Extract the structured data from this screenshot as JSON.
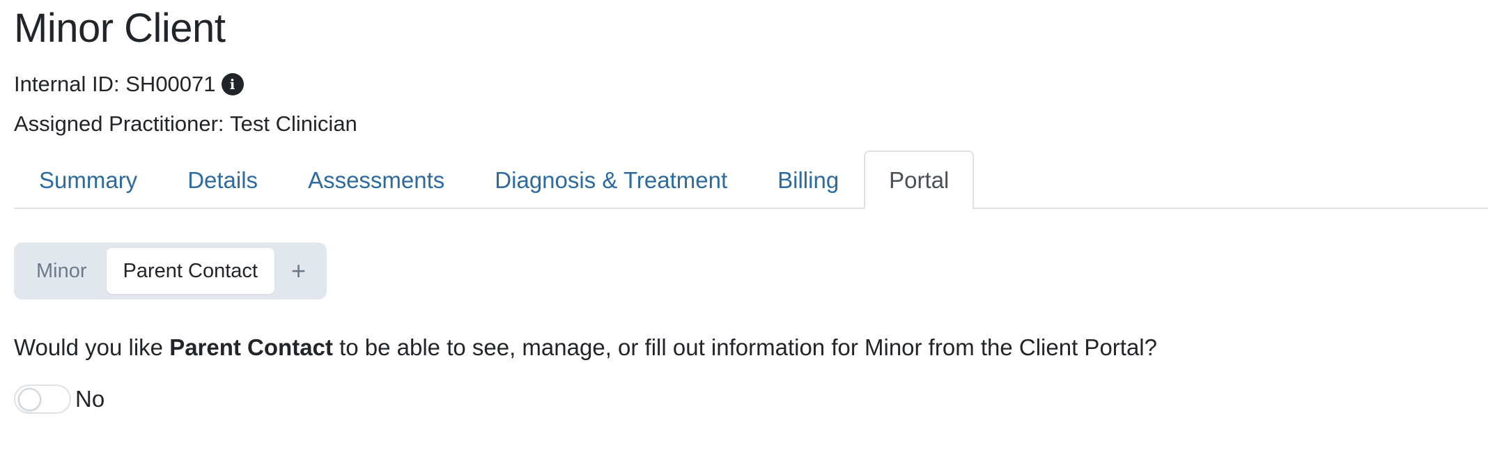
{
  "client": {
    "name": "Minor Client",
    "internal_id_label": "Internal ID:",
    "internal_id": "SH00071",
    "practitioner_label": "Assigned Practitioner:",
    "practitioner": "Test Clinician"
  },
  "tabs": [
    {
      "label": "Summary",
      "active": false
    },
    {
      "label": "Details",
      "active": false
    },
    {
      "label": "Assessments",
      "active": false
    },
    {
      "label": "Diagnosis & Treatment",
      "active": false
    },
    {
      "label": "Billing",
      "active": false
    },
    {
      "label": "Portal",
      "active": true
    }
  ],
  "portal": {
    "subtabs": [
      {
        "label": "Minor",
        "active": false
      },
      {
        "label": "Parent Contact",
        "active": true
      }
    ],
    "add_label": "+",
    "question_prefix": "Would you like",
    "question_contact": "Parent Contact",
    "question_suffix": "to be able to see, manage, or fill out information for Minor from the Client Portal?",
    "toggle_on": false,
    "toggle_label": "No"
  },
  "icons": {
    "info": "info-circle-icon",
    "add": "plus-icon"
  }
}
